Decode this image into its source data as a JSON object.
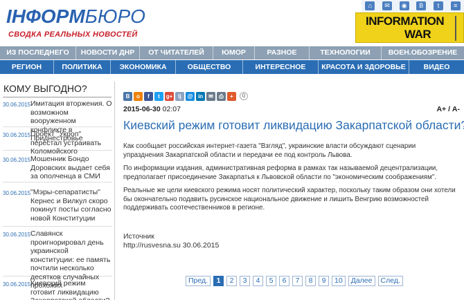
{
  "header": {
    "logo_part1": "ІНФОРМ",
    "logo_part2": "БЮРО",
    "tagline": "СВОДКА РЕАЛЬНЫХ НОВОСТЕЙ",
    "banner_line1": "INFORMATION",
    "banner_line2": "WAR"
  },
  "nav_top": [
    "ИЗ ПОСЛЕДНЕГО",
    "НОВОСТИ ДНР",
    "ОТ ЧИТАТЕЛЕЙ",
    "ЮМОР",
    "РАЗНОЕ",
    "ТЕХНОЛОГИИ",
    "ВОЕН.ОБОЗРЕНИЕ"
  ],
  "nav_bottom": [
    "РЕГИОН",
    "ПОЛИТИКА",
    "ЭКОНОМИКА",
    "ОБЩЕСТВО",
    "ИНТЕРЕСНОЕ",
    "КРАСОТА И ЗДОРОВЬЕ",
    "ВИДЕО"
  ],
  "sidebar": {
    "title": "КОМУ ВЫГОДНО?",
    "items": [
      {
        "date": "30.06.2015",
        "text": "Имитация вторжения. О возможном вооруженном конфликте в Приднестровье"
      },
      {
        "date": "30.06.2015",
        "text": "Проект \"Укроп\" перестал устраивать Коломойского"
      },
      {
        "date": "30.06.2015",
        "text": "Мошенник Бондо Доровских выдает себя за ополченца в СМИ"
      },
      {
        "date": "30.06.2015",
        "text": "\"Мэры-сепаратисты\" Кернес и Вилкул скоро покинут посты согласно новой Конституции"
      },
      {
        "date": "30.06.2015",
        "text": "Славянск проигнорировал день украинской конституции: ее память почтили несколько десятков случайных прохожих"
      },
      {
        "date": "30.06.2015",
        "text": "Киевский режим готовит ликвидацию Закарпатской области?"
      }
    ]
  },
  "article": {
    "share_count": "0",
    "date": "2015-06-30",
    "time": "02:07",
    "font_size_control": "А+ / А-",
    "title": "Киевский режим готовит ликвидацию Закарпатской области?",
    "paragraphs": [
      "Как сообщает российская интернет-газета \"Взгляд\", украинские власти обсуждают сценарии упразднения Закарпатской области и передачи ее под контроль Львова.",
      "По информации издания,  административная реформа в рамках так называемой децентрализации,  предполагает присоединение  Закарпатья  к Львовской области по \"экономическим соображениям\".",
      "Реальные же цели киевского режима носят политический характер, поскольку таким образом они хотели бы окончательно подавить русинское национальное движение и лишить Венгрию возможностей поддерживать соотечественников в регионе."
    ],
    "source_label": "Источник",
    "source_value": "http://rusvesna.su 30.06.2015"
  },
  "share_icons": [
    {
      "name": "vk-icon",
      "glyph": "B",
      "color": "#4a76a8"
    },
    {
      "name": "odnoklassniki-icon",
      "glyph": "o",
      "color": "#ee8208"
    },
    {
      "name": "facebook-icon",
      "glyph": "f",
      "color": "#3b5998"
    },
    {
      "name": "twitter-icon",
      "glyph": "t",
      "color": "#1da1f2"
    },
    {
      "name": "google-plus-icon",
      "glyph": "g+",
      "color": "#dd4b39"
    },
    {
      "name": "livejournal-icon",
      "glyph": "lj",
      "color": "#8aa3c2"
    },
    {
      "name": "mail-ru-icon",
      "glyph": "@",
      "color": "#168de2"
    },
    {
      "name": "linkedin-icon",
      "glyph": "in",
      "color": "#0077b5"
    },
    {
      "name": "email-icon",
      "glyph": "✉",
      "color": "#6a7a8a"
    },
    {
      "name": "print-icon",
      "glyph": "⎙",
      "color": "#6a7a8a"
    },
    {
      "name": "more-share-icon",
      "glyph": "+",
      "color": "#e05a2b"
    }
  ],
  "pagination": {
    "prev": "Пред.",
    "pages": [
      "1",
      "2",
      "3",
      "4",
      "5",
      "6",
      "7",
      "8",
      "9",
      "10"
    ],
    "active_page": "1",
    "next_more": "Далее",
    "next": "След."
  },
  "colors": {
    "brand_blue": "#2a6db4",
    "nav_top_bg": "#8da0b4",
    "tagline_red": "#c8202b",
    "banner_yellow": "#f0d21a"
  }
}
